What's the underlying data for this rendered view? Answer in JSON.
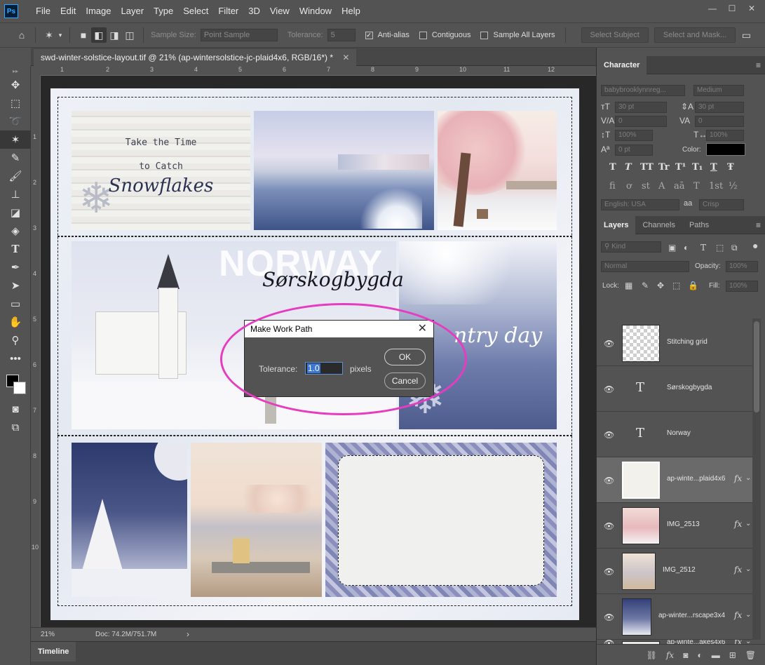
{
  "app": {
    "logo": "Ps",
    "menu": [
      "File",
      "Edit",
      "Image",
      "Layer",
      "Type",
      "Select",
      "Filter",
      "3D",
      "View",
      "Window",
      "Help"
    ],
    "window_controls": [
      "—",
      "☐",
      "✕"
    ]
  },
  "options_bar": {
    "sample_size_label": "Sample Size:",
    "sample_size_value": "Point Sample",
    "tolerance_label": "Tolerance:",
    "tolerance_value": "5",
    "anti_alias_label": "Anti-alias",
    "anti_alias_checked": true,
    "contiguous_label": "Contiguous",
    "contiguous_checked": false,
    "sample_all_layers_label": "Sample All Layers",
    "sample_all_layers_checked": false,
    "select_subject_label": "Select Subject",
    "select_and_mask_label": "Select and Mask..."
  },
  "document": {
    "tab_title": "swd-winter-solstice-layout.tif @ 21% (ap-wintersolstice-jc-plaid4x6, RGB/16*) *",
    "canvas_text": {
      "wood_line1": "Take the Time",
      "wood_line2": "to Catch",
      "wood_line3": "Snowflakes",
      "norway": "NORWAY",
      "norway_script": "Sørskogbygda",
      "country_script": "ntry day"
    },
    "ruler_top": [
      "1",
      "2",
      "3",
      "4",
      "5",
      "6",
      "7",
      "8",
      "9",
      "10",
      "11",
      "12"
    ],
    "ruler_left": [
      "1",
      "2",
      "3",
      "4",
      "5",
      "6",
      "7",
      "8",
      "9",
      "10"
    ]
  },
  "dialog": {
    "title": "Make Work Path",
    "tolerance_label": "Tolerance:",
    "tolerance_value": "1.0",
    "units": "pixels",
    "ok_label": "OK",
    "cancel_label": "Cancel"
  },
  "status": {
    "zoom": "21%",
    "doc_size": "Doc: 74.2M/751.7M",
    "arrow": "›",
    "timeline_label": "Timeline"
  },
  "character_panel": {
    "tab_label": "Character",
    "font_family": "babybrooklynnreg...",
    "font_style": "Medium",
    "font_size": "30 pt",
    "leading": "30 pt",
    "kerning": "0",
    "tracking": "0",
    "vertical_scale": "100%",
    "horizontal_scale": "100%",
    "baseline_shift": "0 pt",
    "color_label": "Color:",
    "color_value": "#000000",
    "style_buttons": [
      "T",
      "T",
      "TT",
      "Tr",
      "T¹",
      "T₁",
      "T",
      "Ŧ"
    ],
    "opentype_buttons": [
      "fi",
      "ơ",
      "st",
      "A",
      "aā",
      "T",
      "1st",
      "½"
    ],
    "language": "English: USA",
    "aa_label": "aa",
    "antialias_method": "Crisp"
  },
  "layers_panel": {
    "tabs": [
      "Layers",
      "Channels",
      "Paths"
    ],
    "filter_kind": "Kind",
    "blend_mode": "Normal",
    "opacity_label": "Opacity:",
    "opacity_value": "100%",
    "lock_label": "Lock:",
    "fill_label": "Fill:",
    "fill_value": "100%",
    "layers": [
      {
        "name": "Stitching grid",
        "kind": "pixel",
        "fx": false,
        "selected": false
      },
      {
        "name": "Sørskogbygda",
        "kind": "text",
        "fx": false,
        "selected": false
      },
      {
        "name": "Norway",
        "kind": "text",
        "fx": false,
        "selected": false
      },
      {
        "name": "ap-winte...plaid4x6",
        "kind": "smart",
        "fx": true,
        "selected": true
      },
      {
        "name": "IMG_2513",
        "kind": "photo",
        "fx": true,
        "selected": false
      },
      {
        "name": "IMG_2512",
        "kind": "photo",
        "fx": true,
        "selected": false
      },
      {
        "name": "ap-winter...rscape3x4",
        "kind": "photo",
        "fx": true,
        "selected": false
      },
      {
        "name": "ap-winte...akes4x6",
        "kind": "photo",
        "fx": true,
        "selected": false
      }
    ],
    "layer_type_glyph": "T",
    "fx_glyph": "fx",
    "chevron_glyph": "⌄"
  }
}
